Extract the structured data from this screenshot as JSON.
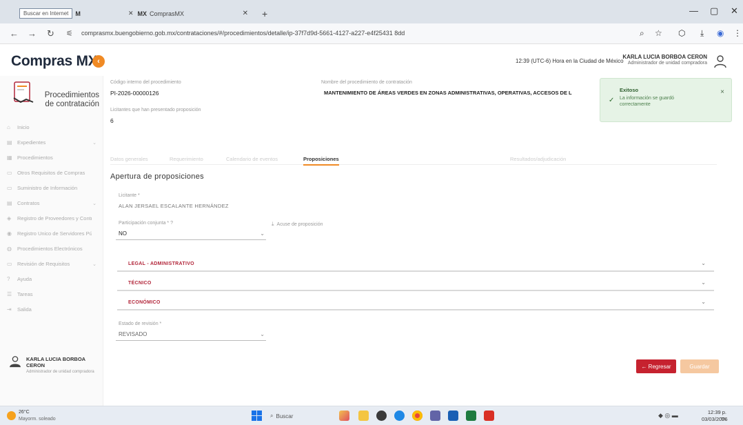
{
  "browser": {
    "tabs": [
      {
        "label": "Buscar en Internet",
        "active": false
      },
      {
        "label": "ComprasMX",
        "active": true
      }
    ],
    "new_tab": "+",
    "url": "comprasmx.buengobierno.gob.mx/contrataciones/#/procedimientos/detalle/ip-37f7d9d-5661-4127-a227-e4f25431 8dd",
    "controls": {
      "minimize": "—",
      "maximize": "▢",
      "close": "✕"
    }
  },
  "header": {
    "logo": "Compras MX",
    "collapse": "‹",
    "time": "12:39 (UTC-6) Hora en la Ciudad de México",
    "user_name": "KARLA LUCIA BORBOA CERON",
    "user_role": "Administrador de unidad compradora"
  },
  "sidebar": {
    "title": "Procedimientos de contratación",
    "items": [
      {
        "label": "Inicio",
        "icon": "⌂",
        "chevron": ""
      },
      {
        "label": "Expedientes",
        "icon": "▤",
        "chevron": "⌄"
      },
      {
        "label": "Procedimientos",
        "icon": "▦",
        "chevron": ""
      },
      {
        "label": "Otros Requisitos de Compras",
        "icon": "▭",
        "chevron": ""
      },
      {
        "label": "Suministro de Información",
        "icon": "▭",
        "chevron": ""
      },
      {
        "label": "Contratos",
        "icon": "▤",
        "chevron": "⌄"
      },
      {
        "label": "Registro de Proveedores y Contratistas (RUPC)",
        "icon": "◈",
        "chevron": ""
      },
      {
        "label": "Registro Unico de Servidores Públicos",
        "icon": "◉",
        "chevron": ""
      },
      {
        "label": "Procedimientos Electrónicos",
        "icon": "◍",
        "chevron": ""
      },
      {
        "label": "Revisión de Requisitos",
        "icon": "▭",
        "chevron": "⌄"
      },
      {
        "label": "Ayuda",
        "icon": "?",
        "chevron": ""
      },
      {
        "label": "Tareas",
        "icon": "☰",
        "chevron": ""
      },
      {
        "label": "Salida",
        "icon": "⇥",
        "chevron": ""
      }
    ],
    "user_name": "KARLA LUCIA BORBOA CERON",
    "user_role": "Administrador de unidad compradora"
  },
  "main": {
    "codigo_label": "Código interno del procedimiento",
    "codigo_value": "PI-2026-00000126",
    "nombre_label": "Nombre del procedimiento de contratación",
    "nombre_value": "MANTENIMIENTO DE ÁREAS VERDES EN ZONAS ADMINISTRATIVAS, OPERATIVAS, ACCESOS DE L",
    "licitantes_label": "Licitantes que han presentado proposición",
    "licitantes_value": "6",
    "tabs": [
      {
        "label": "Datos generales",
        "active": false
      },
      {
        "label": "Requerimiento",
        "active": false
      },
      {
        "label": "Calendario de eventos",
        "active": false
      },
      {
        "label": "Proposiciones",
        "active": true
      },
      {
        "label": "Resultados/adjudicación",
        "active": false
      }
    ],
    "section_title": "Apertura de proposiciones",
    "licitante_label": "Licitante *",
    "licitante_value": "ALAN JERSAEL ESCALANTE HERNÁNDEZ",
    "participacion_label": "Participación conjunta * ?",
    "participacion_value": "NO",
    "acuse_label": "Acuse de proposición",
    "accordions": [
      "LEGAL - ADMINISTRATIVO",
      "TÉCNICO",
      "ECONÓMICO"
    ],
    "estado_label": "Estado de revisión *",
    "estado_value": "REVISADO",
    "btn_regresar": "← Regresar",
    "btn_guardar": "Guardar"
  },
  "toast": {
    "title": "Exitoso",
    "message": "La información se guardó correctamente",
    "close": "×"
  },
  "taskbar": {
    "temp": "26°C",
    "weather": "Mayorm. soleado",
    "search": "Buscar",
    "time": "12:39 p. m.",
    "date": "03/03/2026"
  }
}
